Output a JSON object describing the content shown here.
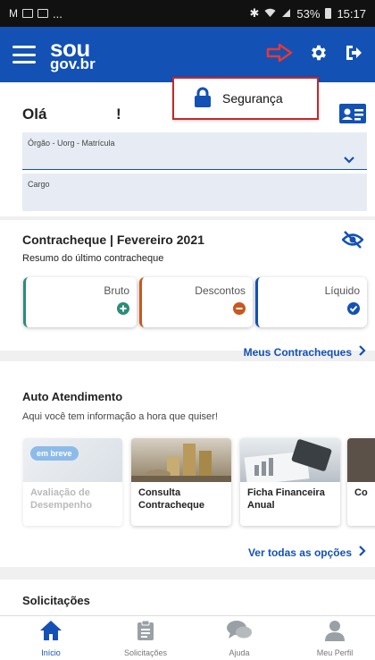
{
  "status_bar": {
    "battery": "53%",
    "time": "15:17"
  },
  "header": {
    "logo_line1": "sou",
    "logo_line2": "gov.br"
  },
  "popup": {
    "label": "Segurança"
  },
  "user": {
    "greeting": "Olá",
    "exclamation": "!",
    "field_orgao_label": "Órgão - Uorg - Matrícula",
    "field_cargo_label": "Cargo"
  },
  "contracheque": {
    "title": "Contracheque | Fevereiro 2021",
    "subtitle": "Resumo do último contracheque",
    "cards": [
      "Bruto",
      "Descontos",
      "Líquido"
    ],
    "link": "Meus Contracheques"
  },
  "auto_atendimento": {
    "title": "Auto Atendimento",
    "subtitle": "Aqui você tem informação a hora que quiser!",
    "badge": "em breve",
    "services": [
      "Avaliação de Desempenho",
      "Consulta Contracheque",
      "Ficha Financeira Anual",
      "Co"
    ],
    "link": "Ver todas as opções"
  },
  "solicitacoes": {
    "title": "Solicitações"
  },
  "bottom_nav": {
    "items": [
      "Início",
      "Solicitações",
      "Ajuda",
      "Meu Perfil"
    ]
  },
  "colors": {
    "primary": "#1351b4",
    "highlight": "#c62828",
    "green": "#2e8b7a",
    "orange": "#c8581e"
  }
}
